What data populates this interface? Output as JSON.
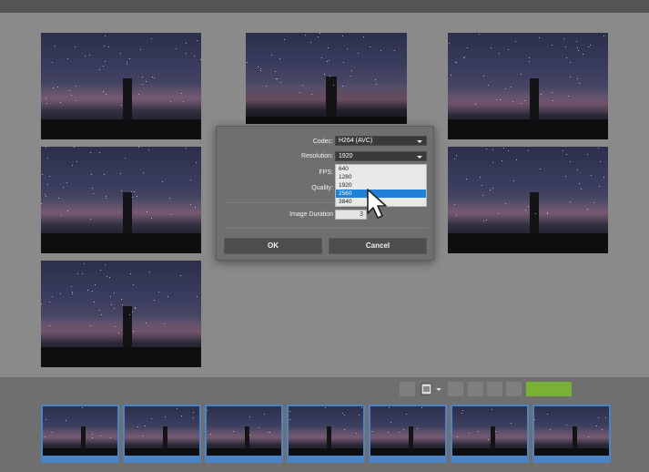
{
  "dialog": {
    "codec_label": "Codec:",
    "codec_value": "H264 (AVC)",
    "resolution_label": "Resolution:",
    "resolution_value": "1920",
    "fps_label": "FPS:",
    "quality_label": "Quality:",
    "image_duration_label": "Image Duration",
    "image_duration_value": "3",
    "resolution_options": [
      "640",
      "1280",
      "1920",
      "2560",
      "3840"
    ],
    "selected_option": "2560",
    "ok_label": "OK",
    "cancel_label": "Cancel"
  },
  "colors": {
    "background": "#8a8a8a",
    "dialog": "#6f6f6f",
    "selection": "#1f82d6",
    "export_button": "#79b134",
    "thumb_border": "#4b84c6"
  },
  "icons": {
    "export": "video-export-icon",
    "dropdown": "chevron-down-icon",
    "cursor": "mouse-pointer-icon"
  }
}
